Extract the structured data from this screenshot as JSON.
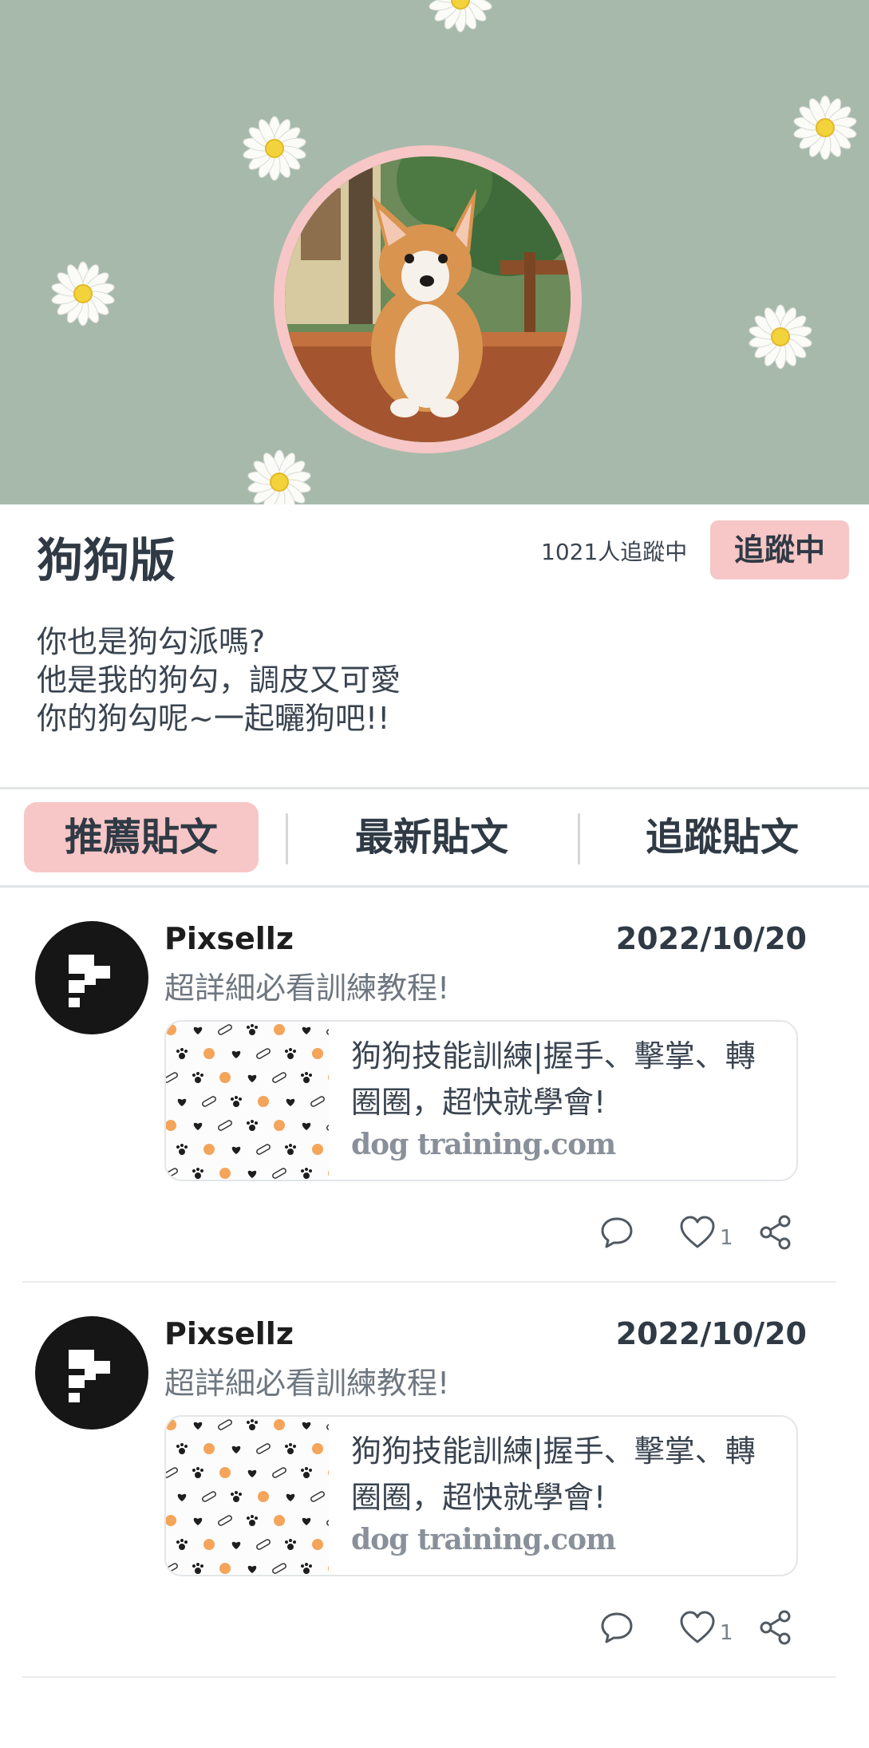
{
  "board": {
    "title": "狗狗版",
    "followers_text": "1021人追蹤中",
    "follow_button_label": "追蹤中",
    "bio_lines": [
      "你也是狗勾派嗎?",
      "他是我的狗勾，調皮又可愛",
      "你的狗勾呢~一起曬狗吧!!"
    ]
  },
  "tabs": [
    {
      "label": "推薦貼文",
      "active": true
    },
    {
      "label": "最新貼文",
      "active": false
    },
    {
      "label": "追蹤貼文",
      "active": false
    }
  ],
  "posts": [
    {
      "author": "Pixsellz",
      "date": "2022/10/20",
      "text": "超詳細必看訓練教程!",
      "link_title": "狗狗技能訓練|握手、擊掌、轉圈圈，超快就學會!",
      "link_domain": "dog training.com",
      "like_count": "1",
      "icons": [
        "comment-icon",
        "heart-icon",
        "share-icon"
      ]
    },
    {
      "author": "Pixsellz",
      "date": "2022/10/20",
      "text": "超詳細必看訓練教程!",
      "link_title": "狗狗技能訓練|握手、擊掌、轉圈圈，超快就學會!",
      "link_domain": "dog training.com",
      "like_count": "1",
      "icons": [
        "comment-icon",
        "heart-icon",
        "share-icon"
      ]
    }
  ],
  "colors": {
    "cover_background": "#a7b9ab",
    "accent_pink": "#f7c6c6",
    "text_dark": "#2f3a45",
    "text_muted": "#6e7780"
  }
}
